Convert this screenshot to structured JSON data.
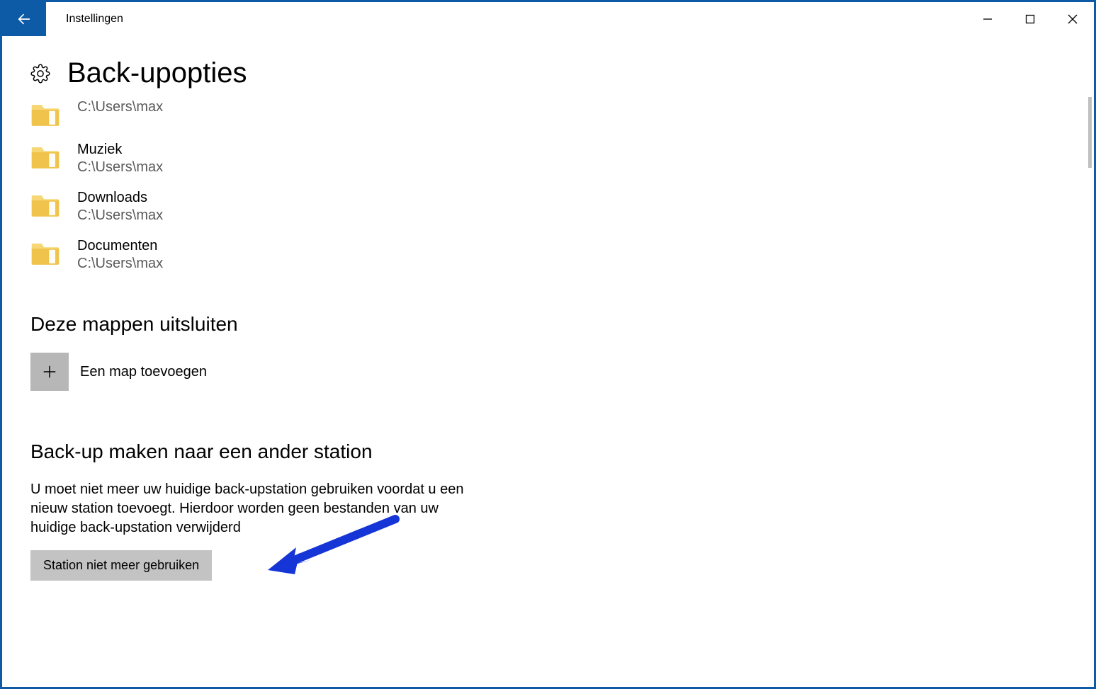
{
  "titlebar": {
    "title": "Instellingen"
  },
  "page": {
    "title": "Back-upopties"
  },
  "folders": [
    {
      "name": "",
      "path": "C:\\Users\\max"
    },
    {
      "name": "Muziek",
      "path": "C:\\Users\\max"
    },
    {
      "name": "Downloads",
      "path": "C:\\Users\\max"
    },
    {
      "name": "Documenten",
      "path": "C:\\Users\\max"
    }
  ],
  "exclude": {
    "heading": "Deze mappen uitsluiten",
    "add_label": "Een map toevoegen"
  },
  "other_drive": {
    "heading": "Back-up maken naar een ander station",
    "description": "U moet niet meer uw huidige back-upstation gebruiken voordat u een nieuw station toevoegt. Hierdoor worden geen bestanden van uw huidige back-upstation verwijderd",
    "button": "Station niet meer gebruiken"
  }
}
